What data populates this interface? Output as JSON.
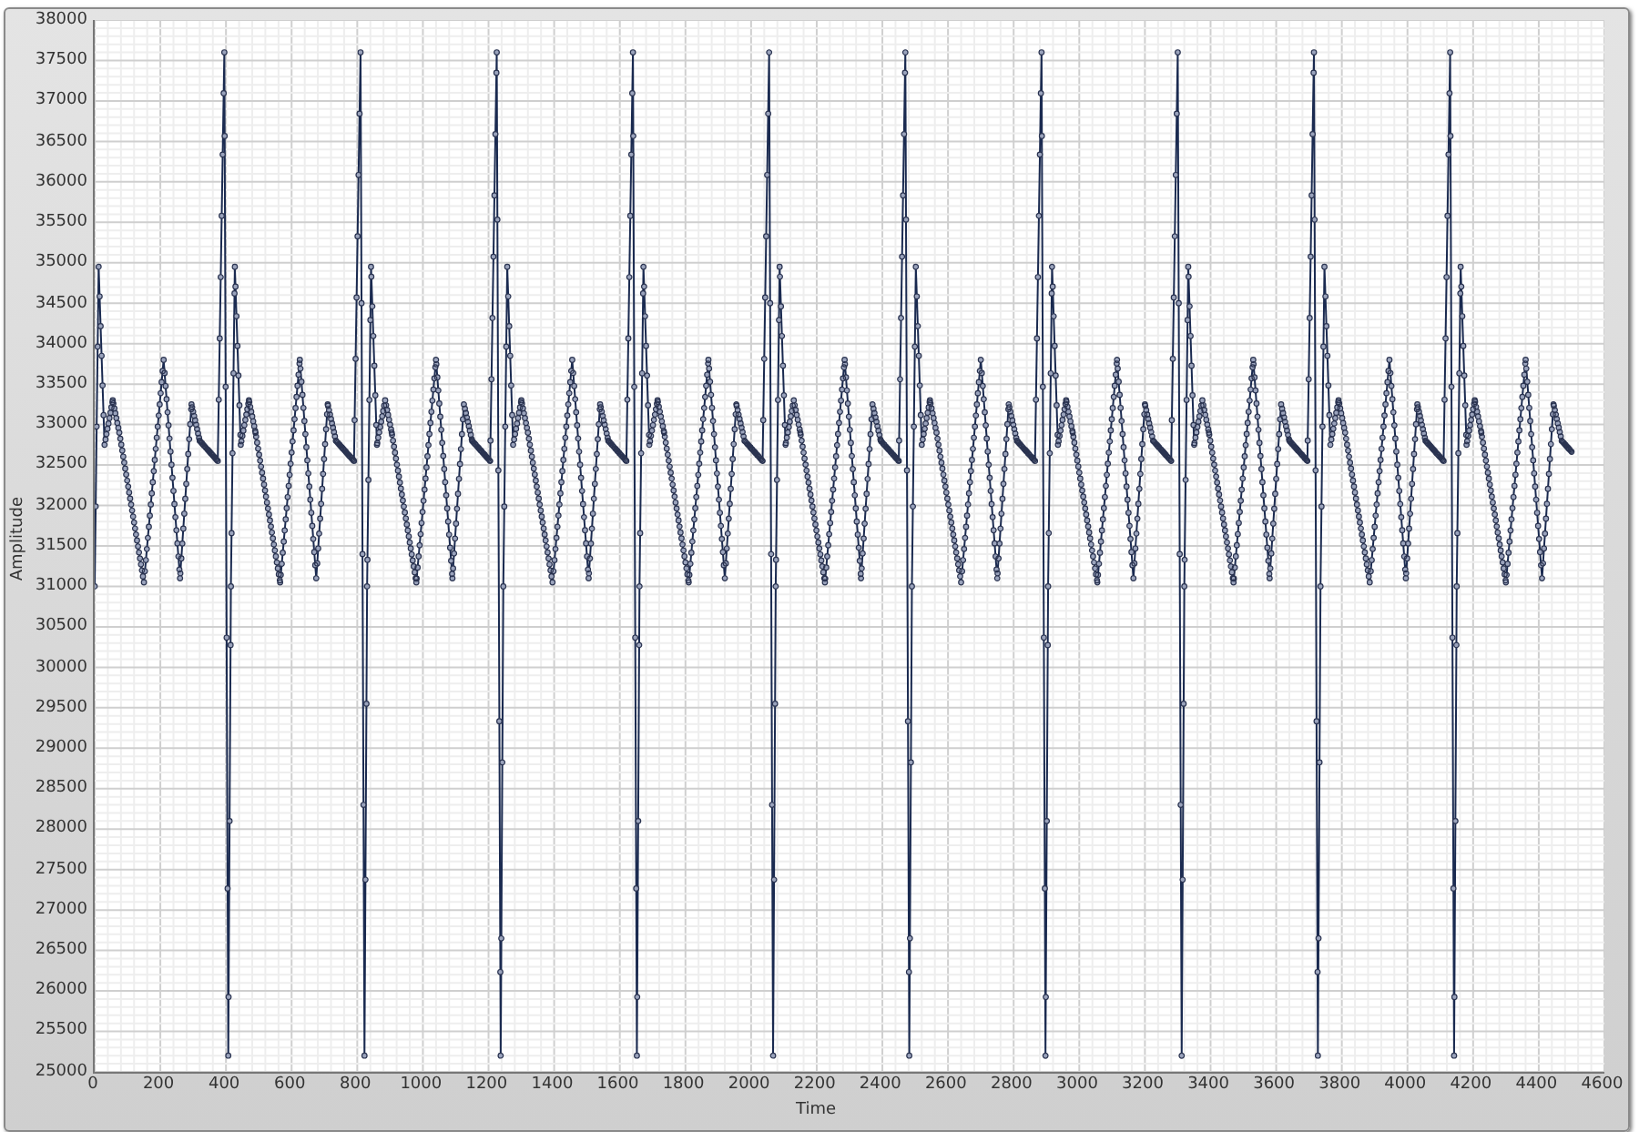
{
  "chart": {
    "y_axis": {
      "label": "Amplitude",
      "ticks": [
        "38000",
        "37500",
        "37000",
        "36500",
        "36000",
        "35500",
        "35000",
        "34500",
        "34000",
        "33500",
        "33000",
        "32500",
        "32000",
        "31500",
        "31000",
        "30500",
        "30000",
        "29500",
        "29000",
        "28500",
        "28000",
        "27500",
        "27000",
        "26500",
        "26000",
        "25500",
        "25000"
      ]
    },
    "x_axis": {
      "label": "Time",
      "ticks": [
        "0",
        "200",
        "400",
        "600",
        "800",
        "1000",
        "1200",
        "1400",
        "1600",
        "1800",
        "2000",
        "2200",
        "2400",
        "2600",
        "2800",
        "3000",
        "3200",
        "3400",
        "3600",
        "3800",
        "4000",
        "4200",
        "4400",
        "4600"
      ]
    }
  }
}
